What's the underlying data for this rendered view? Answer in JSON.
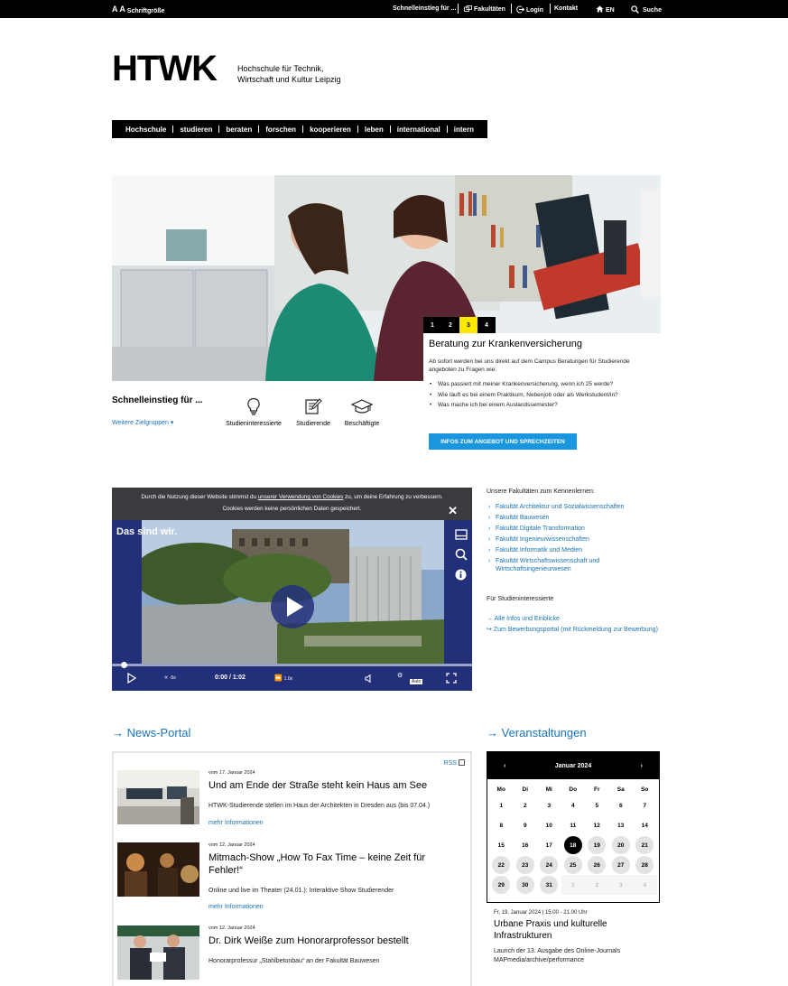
{
  "topbar": {
    "font_size_label": "Schriftgröße",
    "font_size_letters": "A A",
    "quick_entry": "Schnelleinstieg für ...",
    "faculties": "Fakultäten",
    "login": "Login",
    "contact": "Kontakt",
    "language": "EN",
    "search": "Suche"
  },
  "logo": {
    "mark": "HTWK",
    "subtitle_line1": "Hochschule für Technik,",
    "subtitle_line2": "Wirtschaft und Kultur Leipzig"
  },
  "mainnav": [
    "Hochschule",
    "studieren",
    "beraten",
    "forschen",
    "kooperieren",
    "leben",
    "international",
    "intern"
  ],
  "slider": {
    "dots": [
      "1",
      "2",
      "3",
      "4"
    ],
    "active_dot": 2,
    "active_color": "#ffe800",
    "title": "Beratung zur Krankenversicherung",
    "intro": "Ab sofort werden bei uns direkt auf dem Campus Beratungen für Studierende angeboten zu Fragen wie:",
    "bullets": [
      "Was passiert mit meiner Krankenversicherung, wenn ich 25 werde?",
      "Wie läuft es bei einem Praktikum, Nebenjob oder als Werkstudent/in?",
      "Was mache ich bei einem Auslandssemester?"
    ],
    "button": "INFOS ZUM ANGEBOT UND SPRECHZEITEN"
  },
  "quick": {
    "title": "Schnelleinstieg für ...",
    "more": "Weitere Zielgruppen",
    "items": [
      "Studieninteressierte",
      "Studierende",
      "Beschäftigte"
    ]
  },
  "video": {
    "cookie_line1_pre": "Durch die Nutzung dieser Website stimmst du ",
    "cookie_link": "unserer Verwendung von Cookies",
    "cookie_line1_post": " zu, um deine Erfahrung zu verbessern.",
    "cookie_line2": "Cookies werden keine persönlichen Daten gespeichert.",
    "title": "Das sind wir.",
    "time": "0:00 / 1:02",
    "rewind": "-5s",
    "speed": "1.0x",
    "quality": "Auto",
    "progress": 0
  },
  "faculties": {
    "heading": "Unsere Fakultäten zum Kennenlernen:",
    "items": [
      "Fakultät Architektur und Sozialwissenschaften",
      "Fakultät Bauwesen",
      "Fakultät Digitale Transformation",
      "Fakultät Ingenieurwissenschaften",
      "Fakultät Informatik und Medien",
      "Fakultät Wirtschaftswissenschaft und Wirtschaftsingenieurwesen"
    ],
    "heading2": "Für Studieninteressierte",
    "link1": "Alle Infos und Einblicke",
    "link2": "Zum Bewerbungsportal (mit Rückmeldung zur Bewerbung)"
  },
  "news": {
    "heading": "News-Portal",
    "rss": "RSS",
    "items": [
      {
        "date": "vom 17. Januar 2024",
        "title": "Und am Ende der Straße steht kein Haus am See",
        "text": "HTWK-Studierende stellen im Haus der Architekten in Dresden aus (bis 07.04.)",
        "more": "mehr Informationen"
      },
      {
        "date": "vom 12. Januar 2024",
        "title": "Mitmach-Show „How To Fax Time – keine Zeit für Fehler!“",
        "text": "Online und live im Theater (24.01.): Interaktive Show Studierender",
        "more": "mehr Informationen"
      },
      {
        "date": "vom 12. Januar 2024",
        "title": "Dr. Dirk Weiße zum Honorarprofessor bestellt",
        "text": "Honorarprofessur „Stahlbetonbau“ an der Fakultät Bauwesen",
        "more": ""
      }
    ]
  },
  "events": {
    "heading": "Veranstaltungen",
    "month": "Januar 2024",
    "weekdays": [
      "Mo",
      "Di",
      "Mi",
      "Do",
      "Fr",
      "Sa",
      "So"
    ],
    "days": [
      "1",
      "2",
      "3",
      "4",
      "5",
      "6",
      "7",
      "8",
      "9",
      "10",
      "11",
      "12",
      "13",
      "14",
      "15",
      "16",
      "17",
      "18",
      "19",
      "20",
      "21",
      "22",
      "23",
      "24",
      "25",
      "26",
      "27",
      "28",
      "29",
      "30",
      "31",
      "1",
      "2",
      "3",
      "4"
    ],
    "today": "18",
    "event_date": "Fr, 19. Januar 2024 | 15.00 - 21.00 Uhr",
    "event_title": "Urbane Praxis und kulturelle Infrastrukturen",
    "event_text": "Launch der 13. Ausgabe des Online-Journals MAPmedia/archive/performance"
  },
  "colors": {
    "accent": "#1a73b8",
    "button": "#1996dd",
    "highlight": "#ffe800",
    "video_bg": "#22307a"
  }
}
